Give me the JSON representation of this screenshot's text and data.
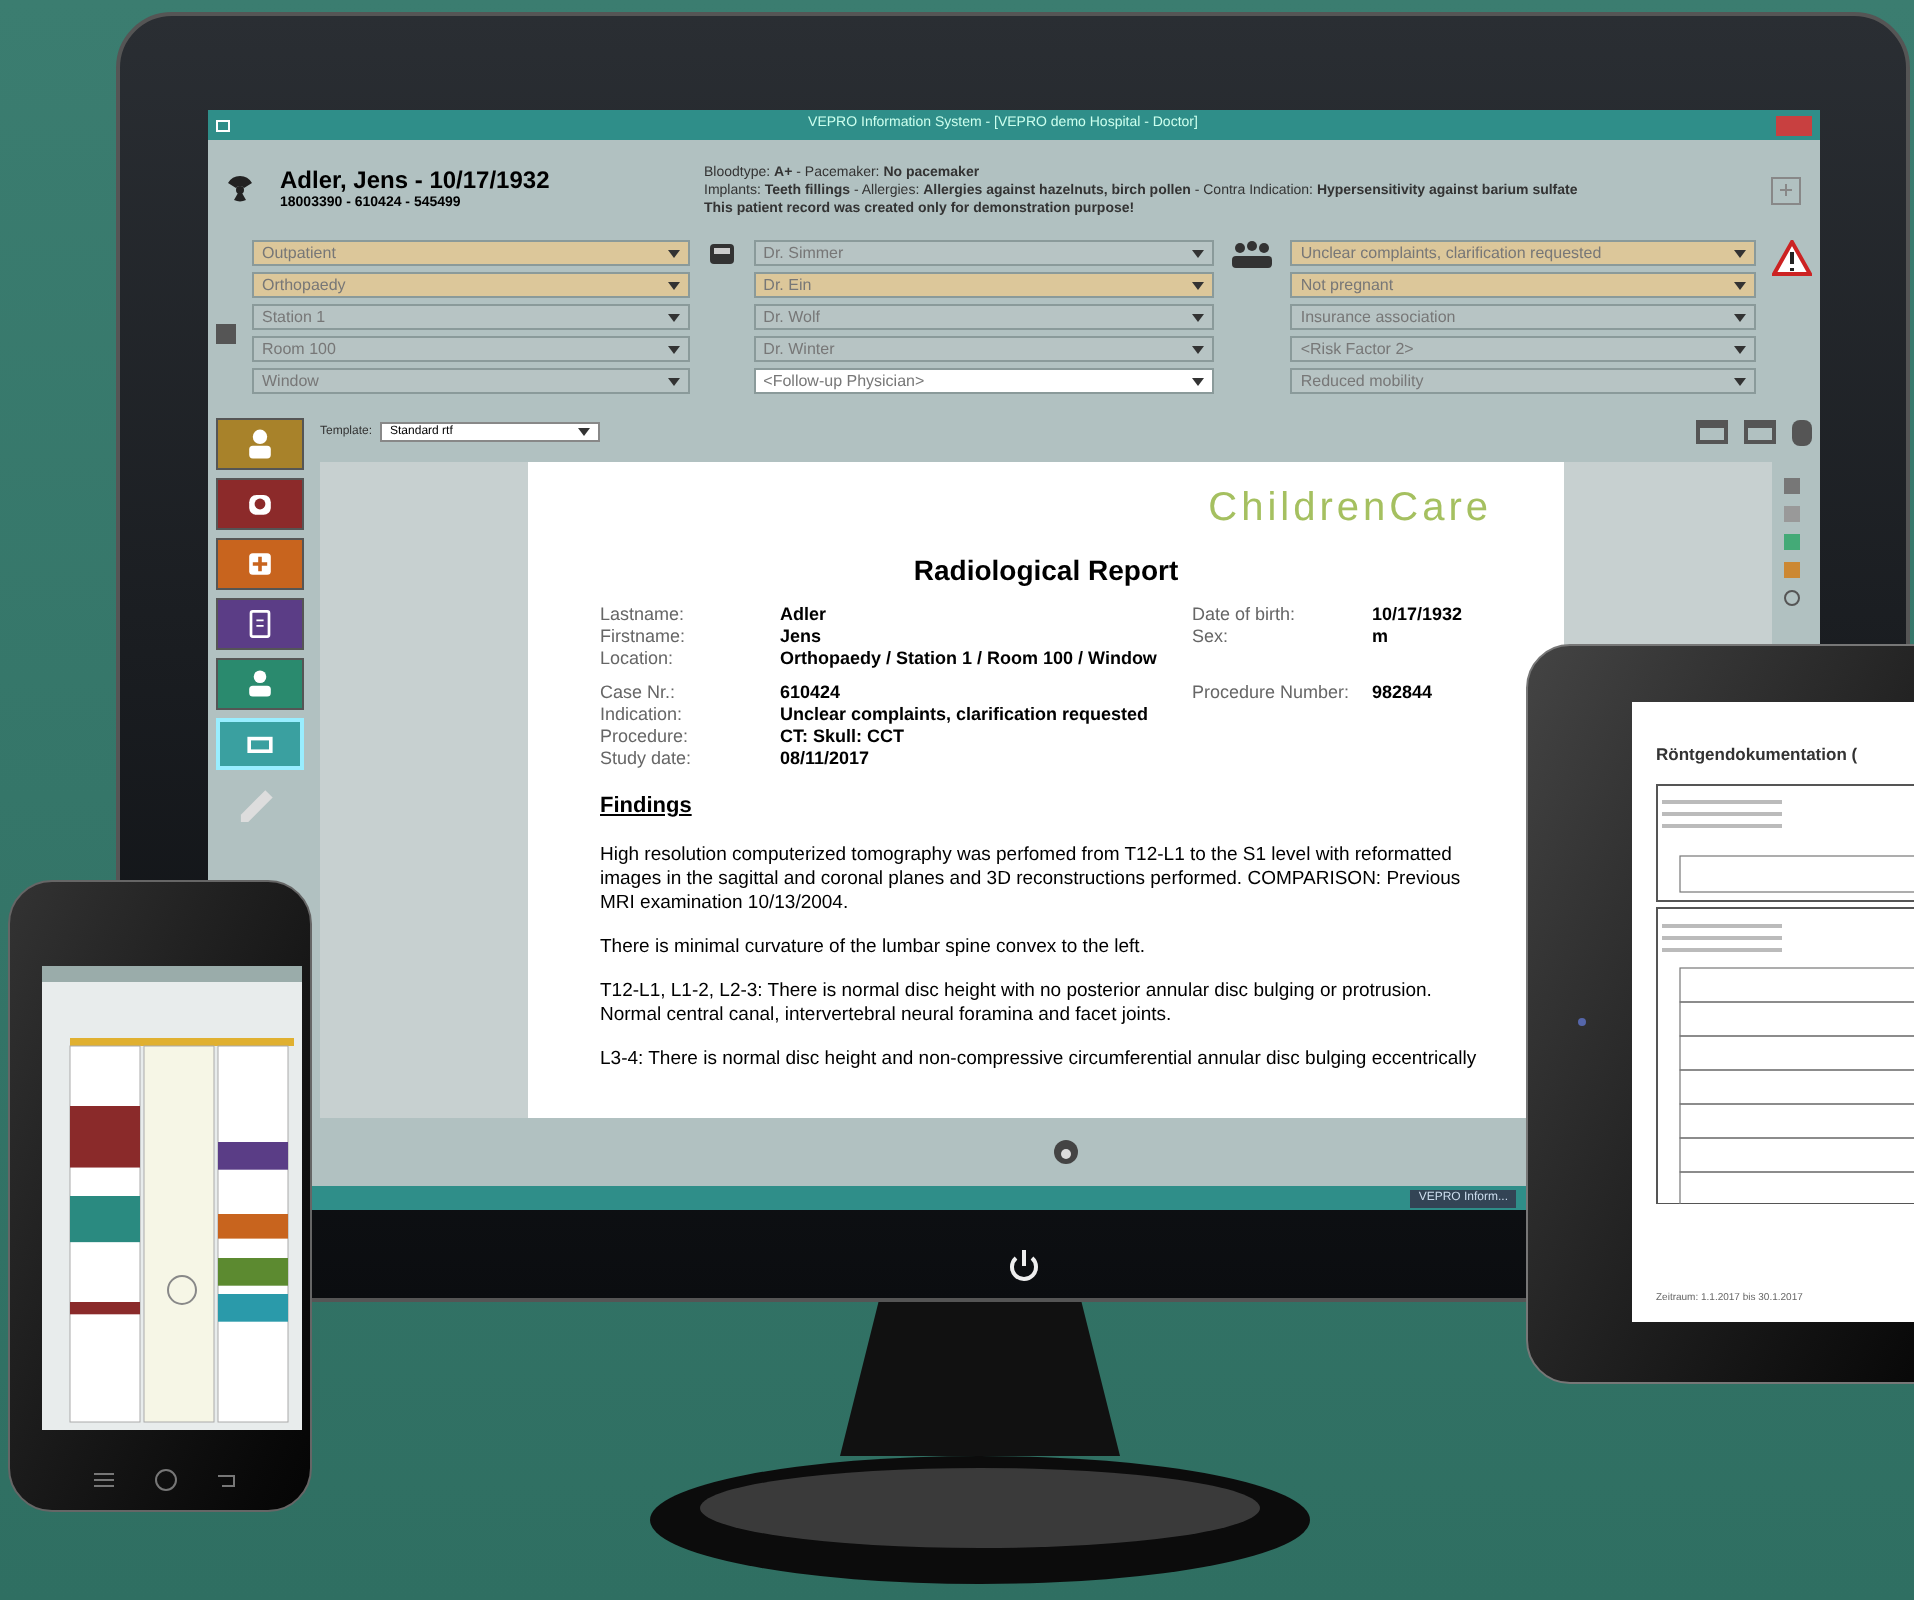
{
  "window": {
    "title": "VEPRO Information System - [VEPRO demo Hospital - Doctor]"
  },
  "patient": {
    "name": "Adler, Jens - 10/17/1932",
    "ids": "18003390  -  610424  -  545499",
    "info": [
      "Bloodtype: **A+**   -   Pacemaker: **No pacemaker**",
      "Implants: **Teeth fillings**   -   Allergies: **Allergies against hazelnuts, birch pollen**   -   Contra Indication: **Hypersensitivity against barium sulfate**",
      "**This patient record was created only for demonstration purpose!**"
    ]
  },
  "dropdowns": [
    [
      {
        "value": "Outpatient",
        "kind": "highlighted"
      },
      {
        "value": "Orthopaedy",
        "kind": "highlighted"
      },
      {
        "value": "Station 1",
        "kind": "plain"
      },
      {
        "value": "Room 100",
        "kind": "plain"
      },
      {
        "value": "Window",
        "kind": "plain"
      }
    ],
    [
      {
        "value": "Dr. Simmer",
        "kind": "plain"
      },
      {
        "value": "Dr. Ein",
        "kind": "highlighted"
      },
      {
        "value": "Dr. Wolf",
        "kind": "plain"
      },
      {
        "value": "Dr. Winter",
        "kind": "plain"
      },
      {
        "value": "<Follow-up Physician>",
        "kind": "input"
      }
    ],
    [
      {
        "value": "Unclear complaints, clarification requested",
        "kind": "highlighted"
      },
      {
        "value": "Not pregnant",
        "kind": "highlighted"
      },
      {
        "value": "Insurance association",
        "kind": "plain"
      },
      {
        "value": "<Risk Factor 2>",
        "kind": "plain"
      },
      {
        "value": "Reduced mobility",
        "kind": "plain"
      }
    ]
  ],
  "template": {
    "label": "Template:",
    "value": "Standard rtf"
  },
  "sidebar": {
    "items": [
      {
        "color": "#a8822a",
        "selected": false
      },
      {
        "color": "#8c2a2a",
        "selected": false
      },
      {
        "color": "#c8641e",
        "selected": false
      },
      {
        "color": "#5b3d86",
        "selected": false
      },
      {
        "color": "#2a8a6e",
        "selected": false
      },
      {
        "color": "#3aa0a0",
        "selected": true
      }
    ]
  },
  "report": {
    "logo": "ChildrenCare",
    "title": "Radiological Report",
    "fields": [
      {
        "label": "Lastname:",
        "value": "Adler"
      },
      {
        "label": "Firstname:",
        "value": "Jens"
      },
      {
        "label": "Location:",
        "value": "Orthopaedy / Station 1 / Room 100 / Window"
      }
    ],
    "side_fields": [
      {
        "label": "Date of birth:",
        "value": "10/17/1932"
      },
      {
        "label": "Sex:",
        "value": "m"
      }
    ],
    "case_fields": [
      {
        "label": "Case Nr.:",
        "value": "610424"
      },
      {
        "label": "Indication:",
        "value": "Unclear complaints, clarification requested"
      },
      {
        "label": "Procedure:",
        "value": "CT: Skull: CCT"
      },
      {
        "label": "Study date:",
        "value": "08/11/2017"
      }
    ],
    "case_side_fields": [
      {
        "label": "Procedure Number:",
        "value": "982844"
      }
    ],
    "heading": "Findings",
    "paragraphs": [
      "High resolution computerized tomography was perfomed from T12-L1 to the S1 level with reformatted images in the sagittal and coronal planes and 3D reconstructions performed. COMPARISON: Previous MRI examination 10/13/2004.",
      "There is minimal curvature of the lumbar spine convex to the left.",
      "T12-L1, L1-2, L2-3: There is normal disc height with no posterior annular disc bulging or protrusion. Normal central canal, intervertebral neural foramina and facet joints.",
      "L3-4: There is normal disc height and non-compressive circumferential annular disc bulging eccentrically"
    ]
  },
  "taskbar": {
    "item": "VEPRO Inform..."
  },
  "tablet": {
    "title": "Röntgendokumentation (",
    "footer": "Zeitraum: 1.1.2017 bis 30.1.2017"
  }
}
